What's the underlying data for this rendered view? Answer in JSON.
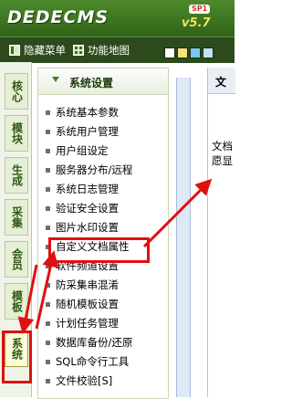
{
  "header": {
    "logo_text": "DEDECMS",
    "badge": "SP1",
    "version": "v5.7"
  },
  "menubar": {
    "items": [
      "隐藏菜单",
      "功能地图"
    ],
    "swatches": [
      "#ffffff",
      "#f6e27a",
      "#7bc6f0",
      "#bfe3f8"
    ]
  },
  "left_tabs": [
    {
      "label": "核心"
    },
    {
      "label": "模块"
    },
    {
      "label": "生成"
    },
    {
      "label": "采集"
    },
    {
      "label": "会员"
    },
    {
      "label": "模板"
    },
    {
      "label": "系统"
    }
  ],
  "panel": {
    "title": "系统设置",
    "items": [
      "系统基本参数",
      "系统用户管理",
      "用户组设定",
      "服务器分布/远程",
      "系统日志管理",
      "验证安全设置",
      "图片水印设置",
      "自定义文档属性",
      "软件频道设置",
      "防采集串混淆",
      "随机模板设置",
      "计划任务管理",
      "数据库备份/还原",
      "SQL命令行工具",
      "文件校验[S]"
    ]
  },
  "right_pane": {
    "header": "文",
    "lines": [
      "文档",
      "愿显"
    ]
  },
  "annotation_color": "#e01010"
}
